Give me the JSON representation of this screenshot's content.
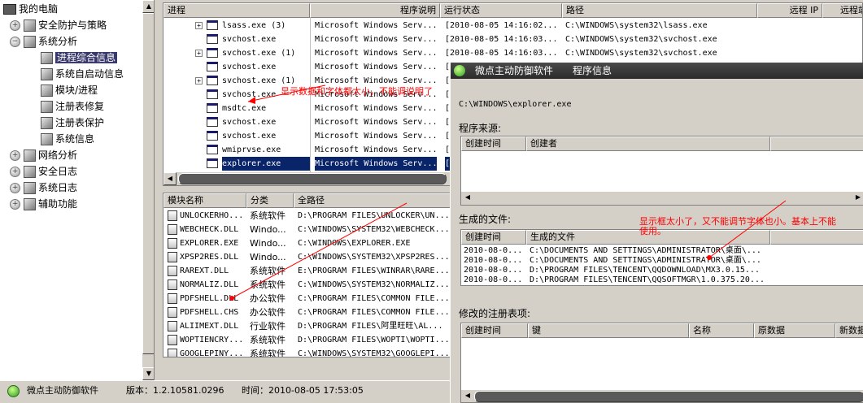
{
  "tree": {
    "root": "我的电脑",
    "items": [
      {
        "label": "安全防护与策略",
        "level": 1
      },
      {
        "label": "系统分析",
        "level": 1
      },
      {
        "label": "进程综合信息",
        "level": 2,
        "selected": true
      },
      {
        "label": "系统自启动信息",
        "level": 2
      },
      {
        "label": "模块/进程",
        "level": 2
      },
      {
        "label": "注册表修复",
        "level": 2
      },
      {
        "label": "注册表保护",
        "level": 2
      },
      {
        "label": "系统信息",
        "level": 2
      },
      {
        "label": "网络分析",
        "level": 1
      },
      {
        "label": "安全日志",
        "level": 1
      },
      {
        "label": "系统日志",
        "level": 1
      },
      {
        "label": "辅助功能",
        "level": 1
      }
    ]
  },
  "process_table": {
    "headers": [
      "进程",
      "程序说明",
      "运行状态",
      "路径",
      "远程 IP",
      "远程端"
    ],
    "rows": [
      {
        "name": "lsass.exe (3)",
        "desc": "Microsoft Windows Serv...",
        "status": "[2010-08-05 14:16:02...",
        "path": "C:\\WINDOWS\\system32\\lsass.exe",
        "expand": true
      },
      {
        "name": "svchost.exe",
        "desc": "Microsoft Windows Serv...",
        "status": "[2010-08-05 14:16:03...",
        "path": "C:\\WINDOWS\\system32\\svchost.exe",
        "expand": false
      },
      {
        "name": "svchost.exe (1)",
        "desc": "Microsoft Windows Serv...",
        "status": "[2010-08-05 14:16:03...",
        "path": "C:\\WINDOWS\\system32\\svchost.exe",
        "expand": true
      },
      {
        "name": "svchost.exe",
        "desc": "Microsoft Windows Serv...",
        "status": "[2",
        "path": "",
        "expand": false
      },
      {
        "name": "svchost.exe (1)",
        "desc": "Microsoft Windows Serv...",
        "status": "[2",
        "path": "",
        "expand": true
      },
      {
        "name": "svchost.exe",
        "desc": "Microsoft Windows Serv...",
        "status": "[2",
        "path": "",
        "expand": false
      },
      {
        "name": "msdtc.exe",
        "desc": "Microsoft Windows Serv...",
        "status": "[2",
        "path": "",
        "expand": false
      },
      {
        "name": "svchost.exe",
        "desc": "Microsoft Windows Serv...",
        "status": "[2",
        "path": "",
        "expand": false
      },
      {
        "name": "svchost.exe",
        "desc": "Microsoft Windows Serv...",
        "status": "[2",
        "path": "",
        "expand": false
      },
      {
        "name": "wmiprvse.exe",
        "desc": "Microsoft Windows Serv...",
        "status": "[2",
        "path": "",
        "expand": false
      },
      {
        "name": "explorer.exe",
        "desc": "Microsoft Windows Serv...",
        "status": "[2",
        "path": "",
        "expand": false,
        "selected": true
      }
    ]
  },
  "module_table": {
    "headers": [
      "模块名称",
      "分类",
      "全路径"
    ],
    "rows": [
      {
        "name": "UNLOCKERHO...",
        "cat": "系统软件",
        "path": "D:\\PROGRAM FILES\\UNLOCKER\\UN..."
      },
      {
        "name": "WEBCHECK.DLL",
        "cat": "Windo...",
        "path": "C:\\WINDOWS\\SYSTEM32\\WEBCHECK..."
      },
      {
        "name": "EXPLORER.EXE",
        "cat": "Windo...",
        "path": "C:\\WINDOWS\\EXPLORER.EXE"
      },
      {
        "name": "XPSP2RES.DLL",
        "cat": "Windo...",
        "path": "C:\\WINDOWS\\SYSTEM32\\XPSP2RES..."
      },
      {
        "name": "RAREXT.DLL",
        "cat": "系统软件",
        "path": "E:\\PROGRAM FILES\\WINRAR\\RARE..."
      },
      {
        "name": "NORMALIZ.DLL",
        "cat": "系统软件",
        "path": "C:\\WINDOWS\\SYSTEM32\\NORMALIZ..."
      },
      {
        "name": "PDFSHELL.DLL",
        "cat": "办公软件",
        "path": "C:\\PROGRAM FILES\\COMMON FILE..."
      },
      {
        "name": "PDFSHELL.CHS",
        "cat": "办公软件",
        "path": "C:\\PROGRAM FILES\\COMMON FILE..."
      },
      {
        "name": "ALIIMEXT.DLL",
        "cat": "行业软件",
        "path": "D:\\PROGRAM FILES\\阿里旺旺\\AL..."
      },
      {
        "name": "WOPTIENCRY...",
        "cat": "系统软件",
        "path": "D:\\PROGRAM FILES\\WOPTI\\WOPTI..."
      },
      {
        "name": "GOOGLEPINY...",
        "cat": "系统软件",
        "path": "C:\\WINDOWS\\SYSTEM32\\GOOGLEPI..."
      }
    ]
  },
  "popup": {
    "app_name": "微点主动防御软件",
    "title": "程序信息",
    "path": "C:\\WINDOWS\\explorer.exe",
    "source_label": "程序来源:",
    "source_headers": [
      "创建时间",
      "创建者"
    ],
    "files_label": "生成的文件:",
    "files_headers": [
      "创建时间",
      "生成的文件"
    ],
    "files_rows": [
      {
        "time": "2010-08-0...",
        "file": "C:\\DOCUMENTS AND SETTINGS\\ADMINISTRATOR\\桌面\\..."
      },
      {
        "time": "2010-08-0...",
        "file": "C:\\DOCUMENTS AND SETTINGS\\ADMINISTRATOR\\桌面\\..."
      },
      {
        "time": "2010-08-0...",
        "file": "D:\\PROGRAM FILES\\TENCENT\\QQDOWNLOAD\\MX3.0.15..."
      },
      {
        "time": "2010-08-0...",
        "file": "D:\\PROGRAM FILES\\TENCENT\\QQSOFTMGR\\1.0.375.20..."
      }
    ],
    "reg_label": "修改的注册表项:",
    "reg_headers": [
      "创建时间",
      "键",
      "名称",
      "原数据",
      "新数据"
    ]
  },
  "annotations": {
    "note1": "显示数据和字体都太小，不能调说明了",
    "note2": "显示框太小了，又不能调节字体也小。基本上不能",
    "note2b": "使用。"
  },
  "statusbar": {
    "app": "微点主动防御软件",
    "version": "版本：1.2.10581.0296",
    "time": "时间：2010-08-05 17:53:05"
  },
  "colors": {
    "selection": "#0a246a",
    "tree_selection": "#39396b",
    "annotation": "#ff0000",
    "popup_title": "#3a3a3a"
  }
}
